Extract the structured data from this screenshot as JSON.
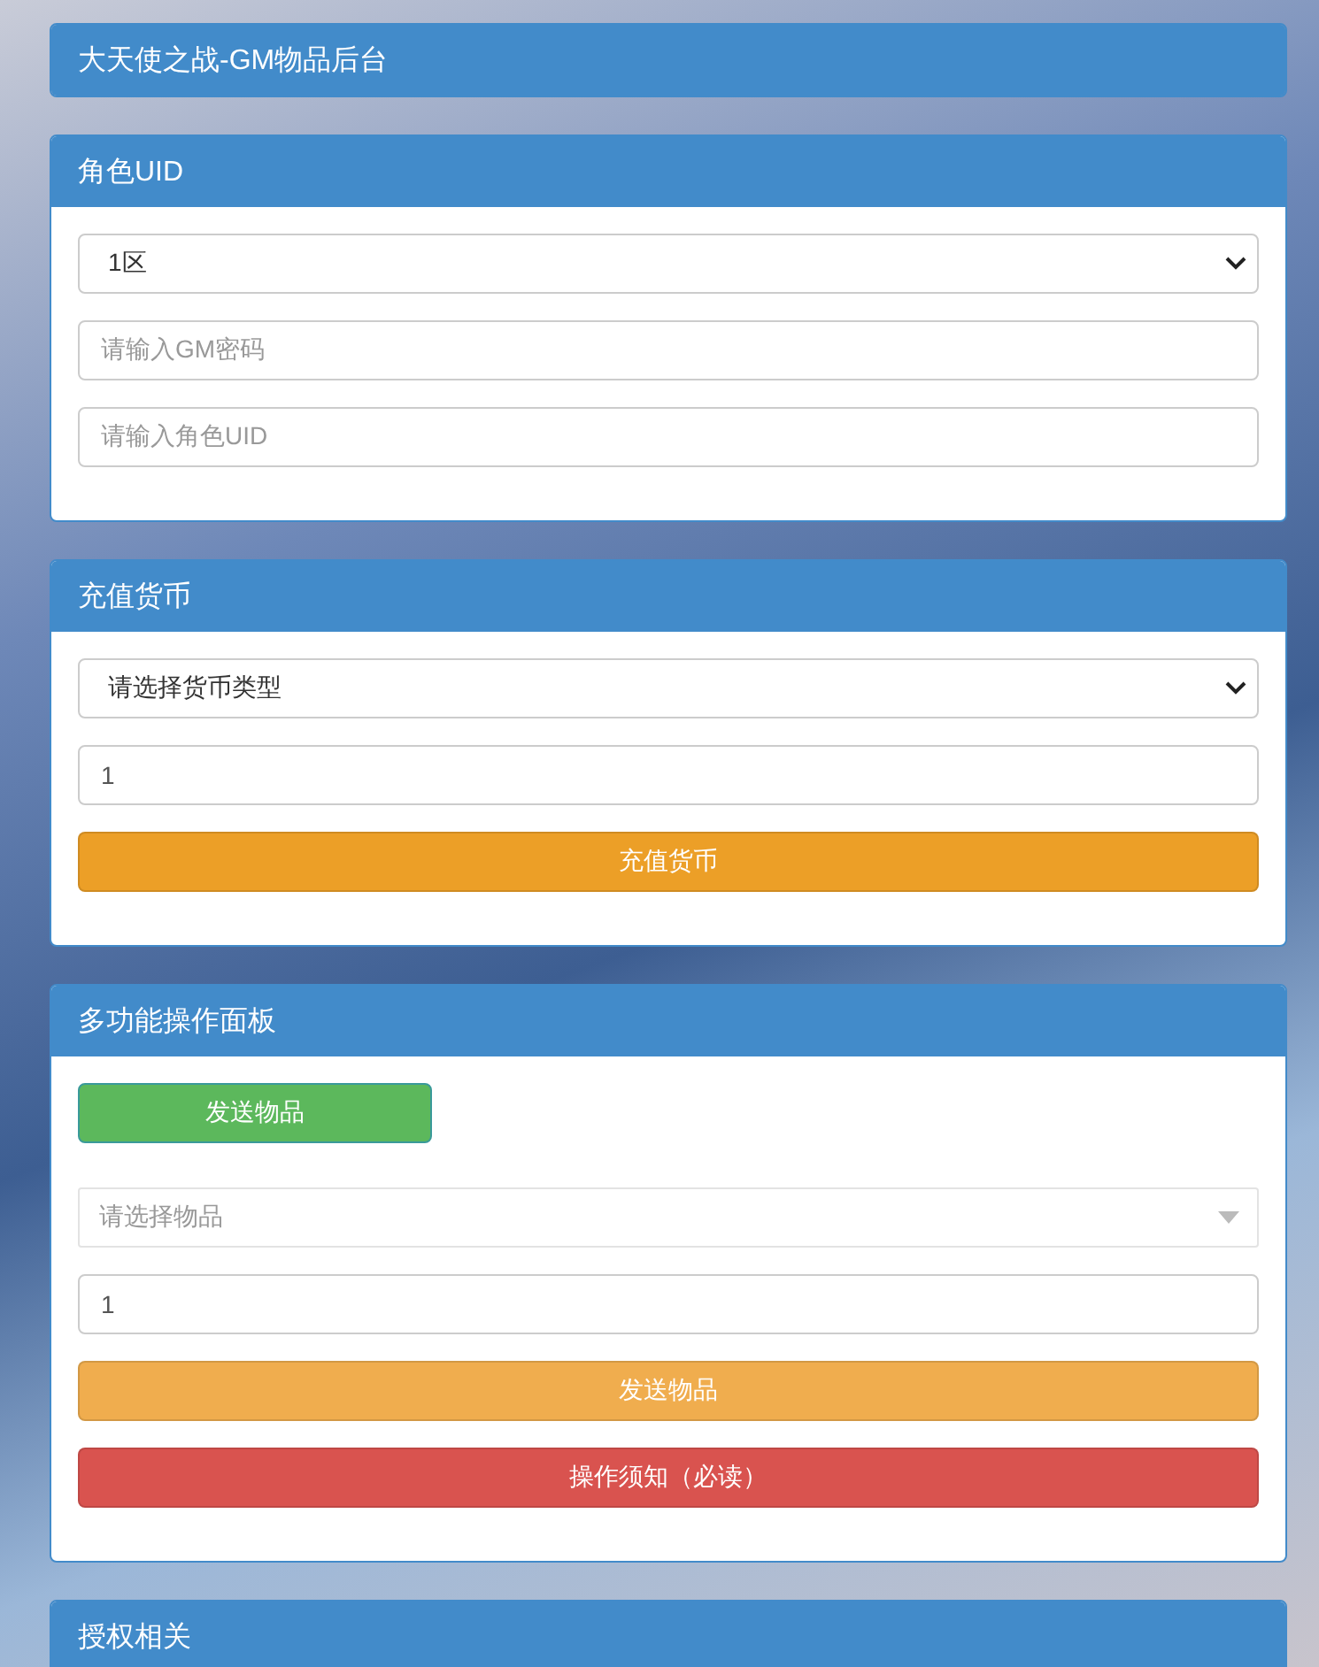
{
  "title": "大天使之战-GM物品后台",
  "panels": [
    {
      "heading": "角色UID",
      "controls": [
        {
          "kind": "select",
          "value": "1区"
        },
        {
          "kind": "input",
          "placeholder": "请输入GM密码"
        },
        {
          "kind": "input",
          "placeholder": "请输入角色UID"
        }
      ]
    },
    {
      "heading": "充值货币",
      "controls": [
        {
          "kind": "select",
          "value": "请选择货币类型"
        },
        {
          "kind": "input",
          "value": "1"
        },
        {
          "kind": "button",
          "color": "#ec9f27",
          "label": "充值货币"
        }
      ]
    },
    {
      "heading": "多功能操作面板",
      "controls": [
        {
          "kind": "tab-button",
          "color": "#5cb85c",
          "label": "发送物品"
        },
        {
          "kind": "search-select",
          "placeholder": "请选择物品"
        },
        {
          "kind": "input",
          "value": "1"
        },
        {
          "kind": "button",
          "color": "#f0ad4e",
          "label": "发送物品"
        },
        {
          "kind": "button",
          "color": "#d9534f",
          "label": "操作须知（必读）"
        }
      ]
    },
    {
      "heading": "授权相关"
    }
  ]
}
